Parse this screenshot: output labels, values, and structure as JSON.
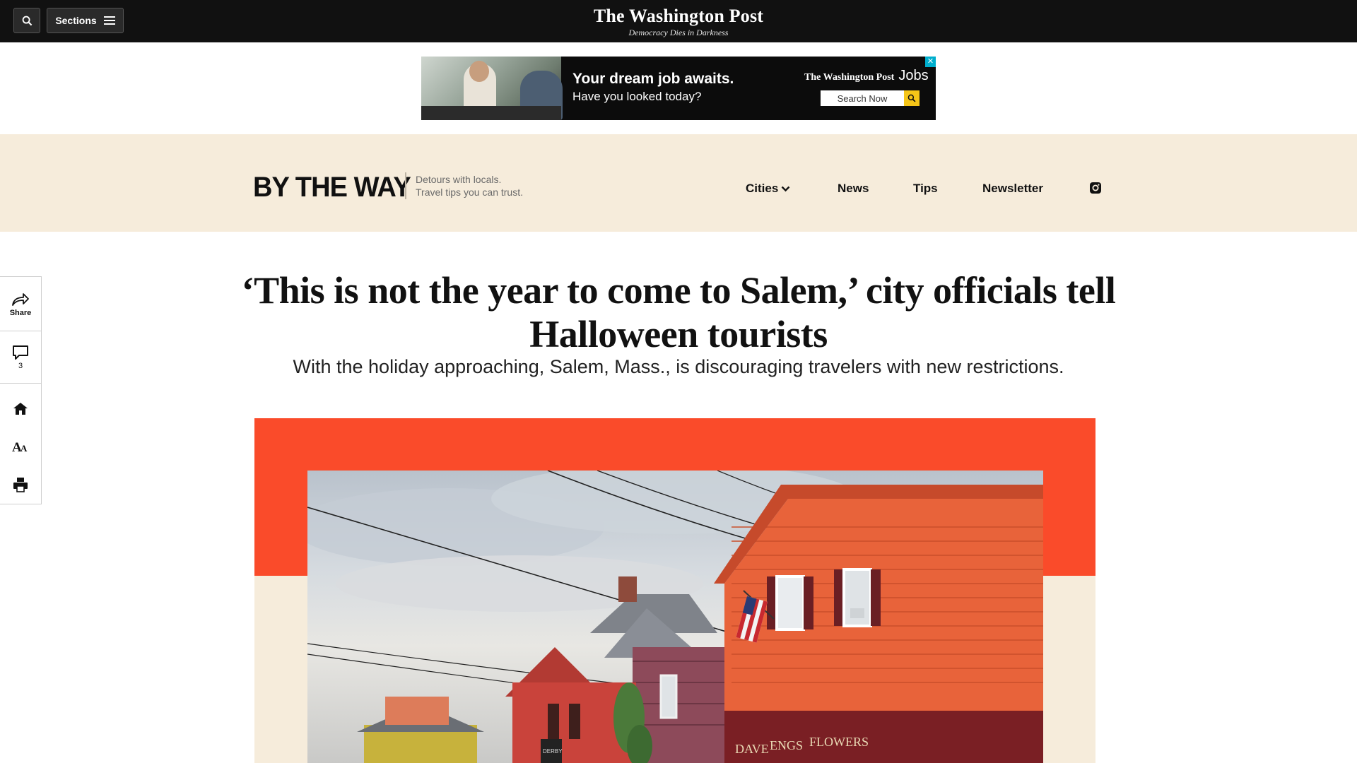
{
  "topbar": {
    "sections_label": "Sections",
    "logo": "The Washington Post",
    "tagline": "Democracy Dies in Darkness"
  },
  "ad": {
    "headline": "Your dream job awaits.",
    "subline": "Have you looked today?",
    "brand": "The Washington Post",
    "brand_suffix": "Jobs",
    "search_label": "Search Now",
    "close_glyph": "✕"
  },
  "banner": {
    "logo_text": "BY THE WAY",
    "tagline_line1": "Detours with locals.",
    "tagline_line2": "Travel tips you can trust.",
    "nav": {
      "cities": "Cities",
      "news": "News",
      "tips": "Tips",
      "newsletter": "Newsletter"
    }
  },
  "rail": {
    "share_label": "Share",
    "comment_count": "3"
  },
  "article": {
    "headline": "‘This is not the year to come to Salem,’ city officials tell Halloween tourists",
    "dek": "With the holiday approaching, Salem, Mass., is discouraging travelers with new restrictions."
  },
  "photo": {
    "sign_flowers": "FLOWERS",
    "sign_dave": "DAVE",
    "sign_engs": "ENGS",
    "sign_derby": "DERBY"
  },
  "colors": {
    "topbar": "#111111",
    "banner": "#f6ecdb",
    "accent_red": "#fa4b2a",
    "house_orange": "#e8633a"
  },
  "icons": [
    "search-icon",
    "hamburger-icon",
    "chevron-down-icon",
    "instagram-icon",
    "share-icon",
    "comment-icon",
    "home-icon",
    "text-size-icon",
    "print-icon"
  ]
}
